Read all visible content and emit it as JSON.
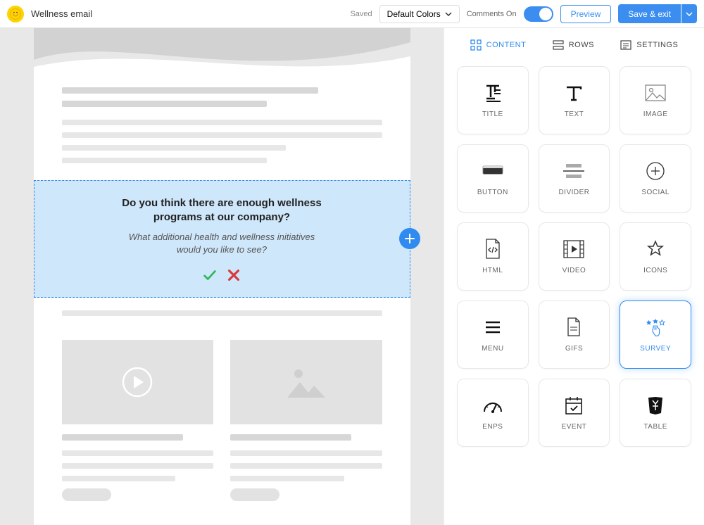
{
  "header": {
    "title": "Wellness email",
    "saved_label": "Saved",
    "color_dropdown": "Default Colors",
    "comments_label": "Comments On",
    "comments_on": true,
    "preview_label": "Preview",
    "save_label": "Save & exit"
  },
  "survey": {
    "question1": "Do you think there are enough wellness programs at our company?",
    "question2": "What additional health and wellness initiatives would you like to see?"
  },
  "sidebar": {
    "tabs": [
      {
        "label": "CONTENT",
        "active": true
      },
      {
        "label": "ROWS",
        "active": false
      },
      {
        "label": "SETTINGS",
        "active": false
      }
    ],
    "tiles": [
      {
        "label": "TITLE",
        "icon": "title"
      },
      {
        "label": "TEXT",
        "icon": "text"
      },
      {
        "label": "IMAGE",
        "icon": "image"
      },
      {
        "label": "BUTTON",
        "icon": "button"
      },
      {
        "label": "DIVIDER",
        "icon": "divider"
      },
      {
        "label": "SOCIAL",
        "icon": "social"
      },
      {
        "label": "HTML",
        "icon": "html"
      },
      {
        "label": "VIDEO",
        "icon": "video"
      },
      {
        "label": "ICONS",
        "icon": "icons"
      },
      {
        "label": "MENU",
        "icon": "menu"
      },
      {
        "label": "GIFS",
        "icon": "gifs"
      },
      {
        "label": "SURVEY",
        "icon": "survey",
        "active": true
      },
      {
        "label": "ENPS",
        "icon": "enps"
      },
      {
        "label": "EVENT",
        "icon": "event"
      },
      {
        "label": "TABLE",
        "icon": "table"
      }
    ]
  }
}
